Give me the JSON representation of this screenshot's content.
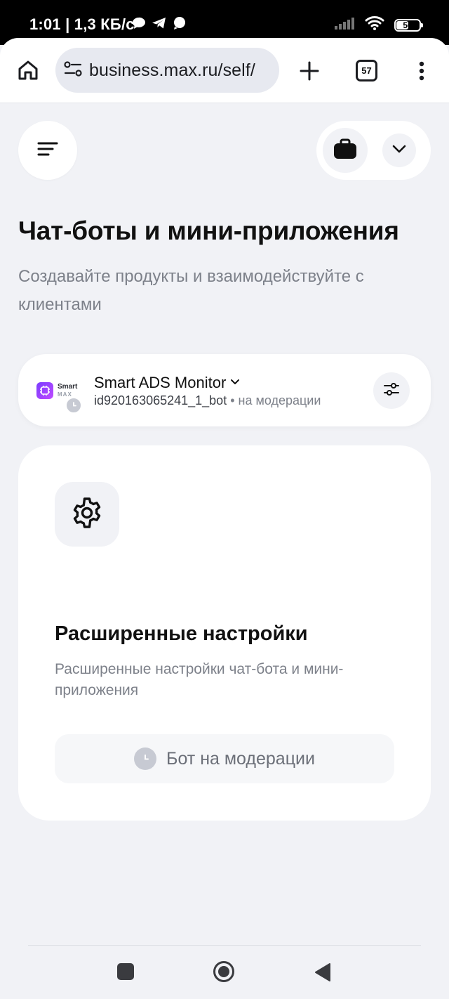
{
  "status_bar": {
    "time": "1:01 | 1,3 КБ/с",
    "battery": "56",
    "battery_level": 0.56,
    "notification_icons": [
      "chat-bubble-icon",
      "telegram-icon",
      "message-icon"
    ]
  },
  "browser": {
    "url": "business.max.ru/self/",
    "tab_count": "57"
  },
  "page": {
    "title": "Чат-боты и мини-приложения",
    "subtitle": "Создавайте продукты и взаимодействуйте с клиентами"
  },
  "bot": {
    "name": "Smart ADS Monitor",
    "id": "id920163065241_1_bot",
    "status": " • на модерации",
    "logo_text": "Smart",
    "logo_sub": "MAX"
  },
  "settings_card": {
    "title": "Расширенные настройки",
    "description": "Расширенные настройки чат-бота и мини-приложения",
    "button_label": "Бот на модерации"
  },
  "colors": {
    "background": "#f1f2f6",
    "card": "#ffffff",
    "muted_text": "#7d818a",
    "accent": "#7a3cff"
  }
}
